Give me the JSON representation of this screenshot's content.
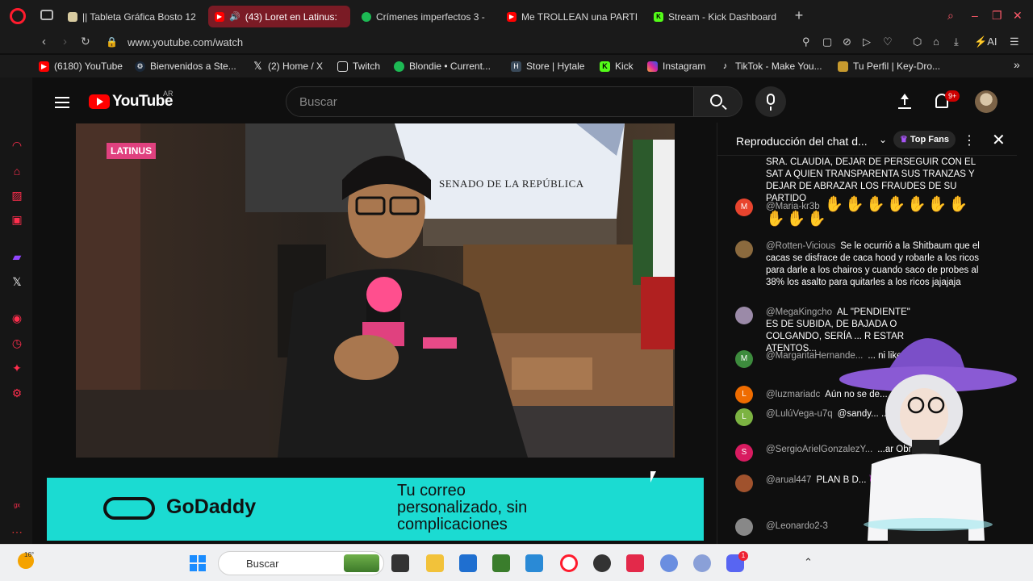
{
  "browser": {
    "tabs": [
      {
        "title": "|| Tableta Gráfica Bosto 12",
        "icon": "generic-favicon-icon",
        "active": false
      },
      {
        "title": "(43) Loret en Latinus:",
        "icon": "youtube-favicon-icon",
        "active": true
      },
      {
        "title": "Crímenes imperfectos 3 -",
        "icon": "spotify-favicon-icon",
        "active": false
      },
      {
        "title": "Me TROLLEAN una PARTI",
        "icon": "youtube-favicon-icon",
        "active": false
      },
      {
        "title": "Stream - Kick Dashboard",
        "icon": "kick-favicon-icon",
        "active": false
      }
    ],
    "url": "www.youtube.com/watch",
    "ai_label": "AI",
    "bookmarks": [
      {
        "label": "(6180) YouTube",
        "icon": "youtube-favicon-icon"
      },
      {
        "label": "Bienvenidos a Ste...",
        "icon": "steam-favicon-icon"
      },
      {
        "label": "(2) Home / X",
        "icon": "x-favicon-icon"
      },
      {
        "label": "Twitch",
        "icon": "twitch-favicon-icon"
      },
      {
        "label": "Blondie • Current...",
        "icon": "spotify-favicon-icon"
      },
      {
        "label": "Store | Hytale",
        "icon": "hytale-favicon-icon"
      },
      {
        "label": "Kick",
        "icon": "kick-favicon-icon"
      },
      {
        "label": "Instagram",
        "icon": "instagram-favicon-icon"
      },
      {
        "label": "TikTok - Make You...",
        "icon": "tiktok-favicon-icon"
      },
      {
        "label": "Tu Perfil | Key-Dro...",
        "icon": "keydrop-favicon-icon"
      }
    ]
  },
  "youtube": {
    "logo_text": "YouTube",
    "region": "AR",
    "search_placeholder": "Buscar",
    "notification_count": "9+",
    "video": {
      "channel_tag": "LATINUS",
      "backdrop_text": "SENADO DE LA REPÚBLICA"
    },
    "ad": {
      "brand": "GoDaddy",
      "copy_line1": "Tu correo",
      "copy_line2": "personalizado, sin",
      "copy_line3": "complicaciones"
    },
    "chat": {
      "title": "Reproducción del chat d...",
      "top_fans_label": "Top Fans",
      "messages": [
        {
          "author": "",
          "avatar": "",
          "avatar_color": "#0f0f0f",
          "text": "SRA. CLAUDIA, DEJAR DE PERSEGUIR CON EL SAT A QUIEN TRANSPARENTA SUS TRANZAS Y DEJAR DE ABRAZAR LOS FRAUDES DE SU PARTIDO"
        },
        {
          "author": "@Maria-kr3b",
          "avatar": "M",
          "avatar_color": "#e8442e",
          "text": "✋✋✋✋✋✋✋ ✋✋✋"
        },
        {
          "author": "@Rotten-Vicious",
          "avatar": "",
          "avatar_color": "#8b6a3e",
          "text": "Se le ocurrió a la Shitbaum que el cacas se disfrace de caca hood y robarle a los ricos para darle a los chairos y cuando saco de probes al 38% los asalto para quitarles a los ricos jajajaja"
        },
        {
          "author": "@MegaKingcho",
          "avatar": "",
          "avatar_color": "#9b8aa8",
          "text": "AL \"PENDIENTE\" ES DE SUBIDA, DE BAJADA O COLGANDO, SERÍA ... R ESTAR ATENTOS..."
        },
        {
          "author": "@MargaritaHernande...",
          "avatar": "M",
          "avatar_color": "#3d8b3d",
          "text": "... ni like 👍 ❤"
        },
        {
          "author": "@luzmariadc",
          "avatar": "L",
          "avatar_color": "#ef6c00",
          "text": "Aún no se de..."
        },
        {
          "author": "@LulúVega-u7q",
          "avatar": "L",
          "avatar_color": "#7cb342",
          "text": "@sandy... ...lo. Saludos 🌹 🌷"
        },
        {
          "author": "@SergioArielGonzalezY...",
          "avatar": "S",
          "avatar_color": "#d81b60",
          "text": "...ar Obrador"
        },
        {
          "author": "@arual447",
          "avatar": "",
          "avatar_color": "#a0522d",
          "text": "PLAN B D... 👿👿👿"
        },
        {
          "author": "@Leonardo2-3",
          "avatar": "",
          "avatar_color": "#888888",
          "text": ""
        }
      ]
    }
  },
  "taskbar": {
    "temperature": "16°",
    "search_placeholder": "Buscar",
    "discord_badge": "1"
  },
  "colors": {
    "opera_red": "#ff1b2d",
    "youtube_red": "#ff0000",
    "active_tab": "#7a1b25",
    "godaddy_teal": "#1bdbd2",
    "latinus_pink": "#e0417f"
  }
}
